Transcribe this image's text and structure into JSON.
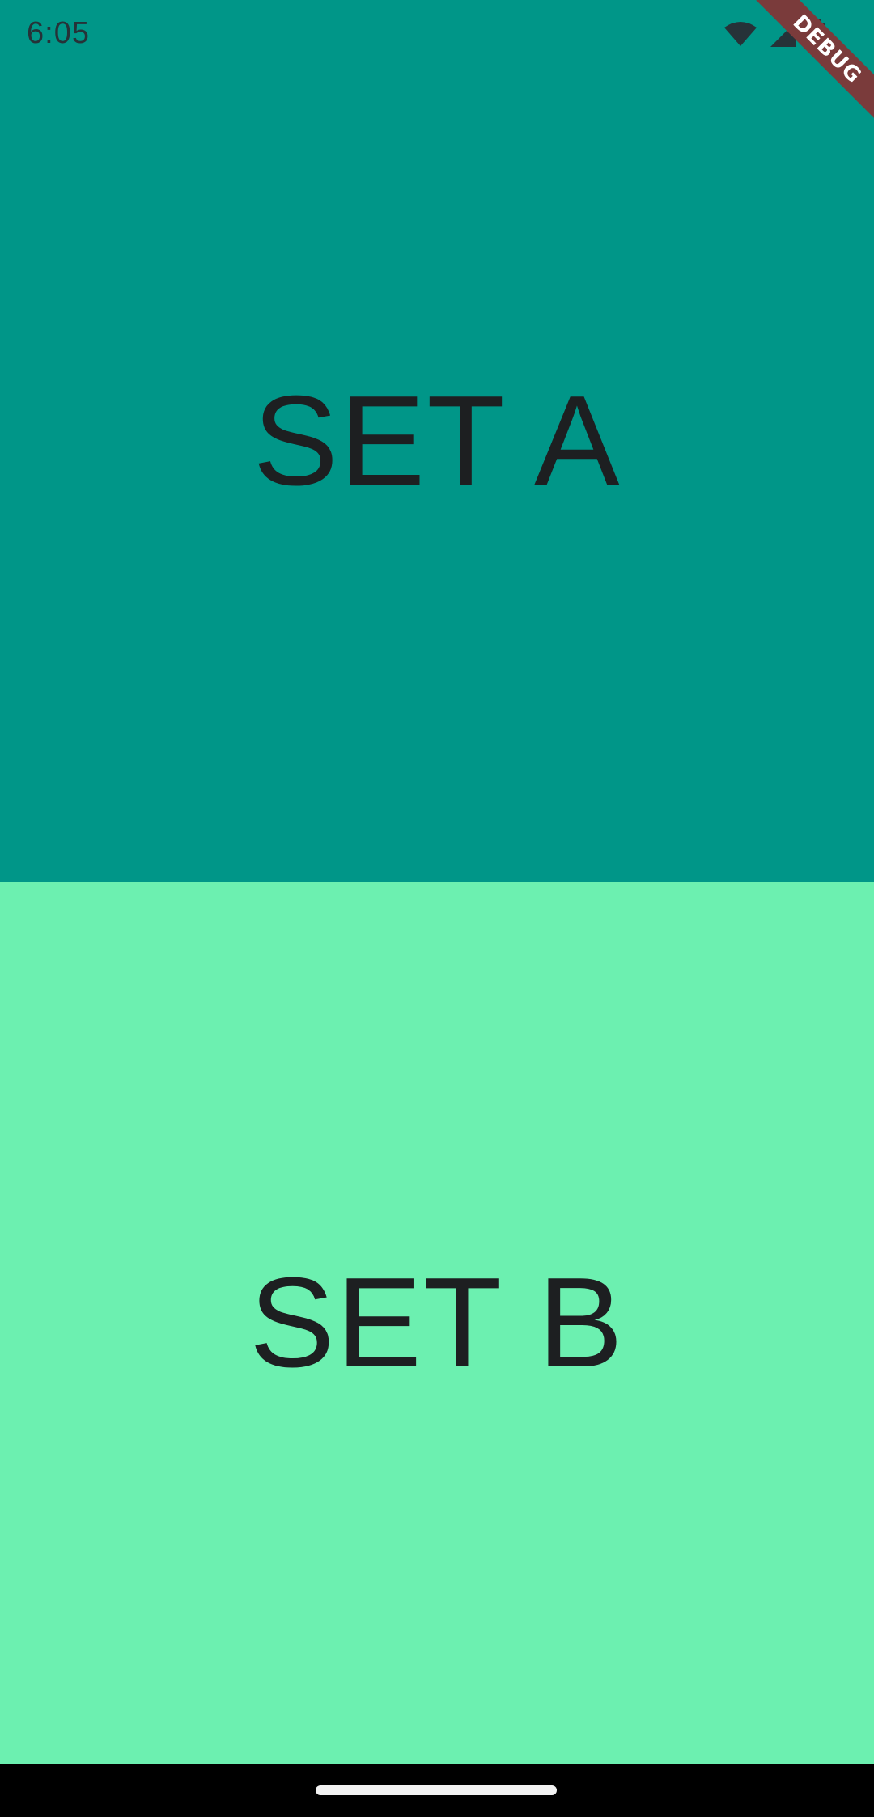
{
  "status_bar": {
    "time": "6:05",
    "icons": [
      "wifi-icon",
      "signal-icon",
      "battery-icon"
    ]
  },
  "debug_banner": {
    "label": "DEBUG",
    "color": "#7a3b3b"
  },
  "panels": [
    {
      "label": "SET A",
      "color": "#009688"
    },
    {
      "label": "SET B",
      "color": "#6cf0b0"
    }
  ],
  "nav_bar": {
    "color": "#000000",
    "indicator_color": "#f2f2f2"
  }
}
